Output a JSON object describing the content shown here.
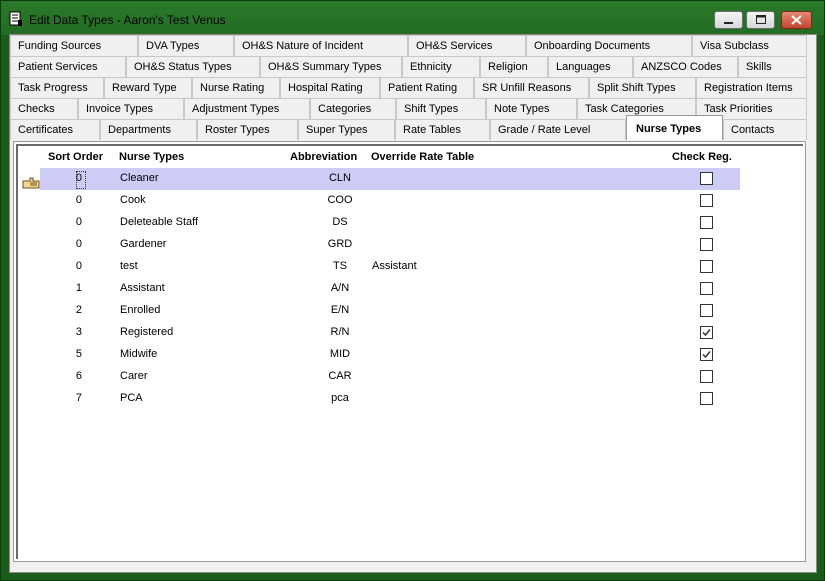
{
  "window": {
    "title": "Edit Data Types  -  Aaron's Test Venus"
  },
  "tab_rows": [
    [
      "Funding Sources",
      "DVA Types",
      "OH&S Nature of Incident",
      "OH&S Services",
      "Onboarding Documents",
      "Visa Subclass"
    ],
    [
      "Patient Services",
      "OH&S Status Types",
      "OH&S Summary Types",
      "Ethnicity",
      "Religion",
      "Languages",
      "ANZSCO Codes",
      "Skills"
    ],
    [
      "Task Progress",
      "Reward Type",
      "Nurse Rating",
      "Hospital Rating",
      "Patient Rating",
      "SR Unfill Reasons",
      "Split Shift Types",
      "Registration Items"
    ],
    [
      "Checks",
      "Invoice Types",
      "Adjustment Types",
      "Categories",
      "Shift Types",
      "Note Types",
      "Task Categories",
      "Task Priorities"
    ],
    [
      "Certificates",
      "Departments",
      "Roster Types",
      "Super Types",
      "Rate Tables",
      "Grade / Rate Level",
      "Nurse Types",
      "Contacts"
    ]
  ],
  "active_tab": "Nurse Types",
  "grid": {
    "columns": {
      "sort_order": "Sort Order",
      "nurse_types": "Nurse Types",
      "abbreviation": "Abbreviation",
      "override_rate_table": "Override Rate Table",
      "check_reg": "Check Reg."
    },
    "rows": [
      {
        "sort": "0",
        "name": "Cleaner",
        "abbr": "CLN",
        "override": "",
        "check": false,
        "selected": true
      },
      {
        "sort": "0",
        "name": "Cook",
        "abbr": "COO",
        "override": "",
        "check": false
      },
      {
        "sort": "0",
        "name": "Deleteable Staff",
        "abbr": "DS",
        "override": "",
        "check": false
      },
      {
        "sort": "0",
        "name": "Gardener",
        "abbr": "GRD",
        "override": "",
        "check": false
      },
      {
        "sort": "0",
        "name": "test",
        "abbr": "TS",
        "override": "Assistant",
        "check": false
      },
      {
        "sort": "1",
        "name": "Assistant",
        "abbr": "A/N",
        "override": "",
        "check": false
      },
      {
        "sort": "2",
        "name": "Enrolled",
        "abbr": "E/N",
        "override": "",
        "check": false
      },
      {
        "sort": "3",
        "name": "Registered",
        "abbr": "R/N",
        "override": "",
        "check": true
      },
      {
        "sort": "5",
        "name": "Midwife",
        "abbr": "MID",
        "override": "",
        "check": true
      },
      {
        "sort": "6",
        "name": "Carer",
        "abbr": "CAR",
        "override": "",
        "check": false
      },
      {
        "sort": "7",
        "name": "PCA",
        "abbr": "pca",
        "override": "",
        "check": false
      }
    ]
  },
  "colors": {
    "window_frame": "#1a5c1a",
    "selected_row": "#ccccf6"
  }
}
